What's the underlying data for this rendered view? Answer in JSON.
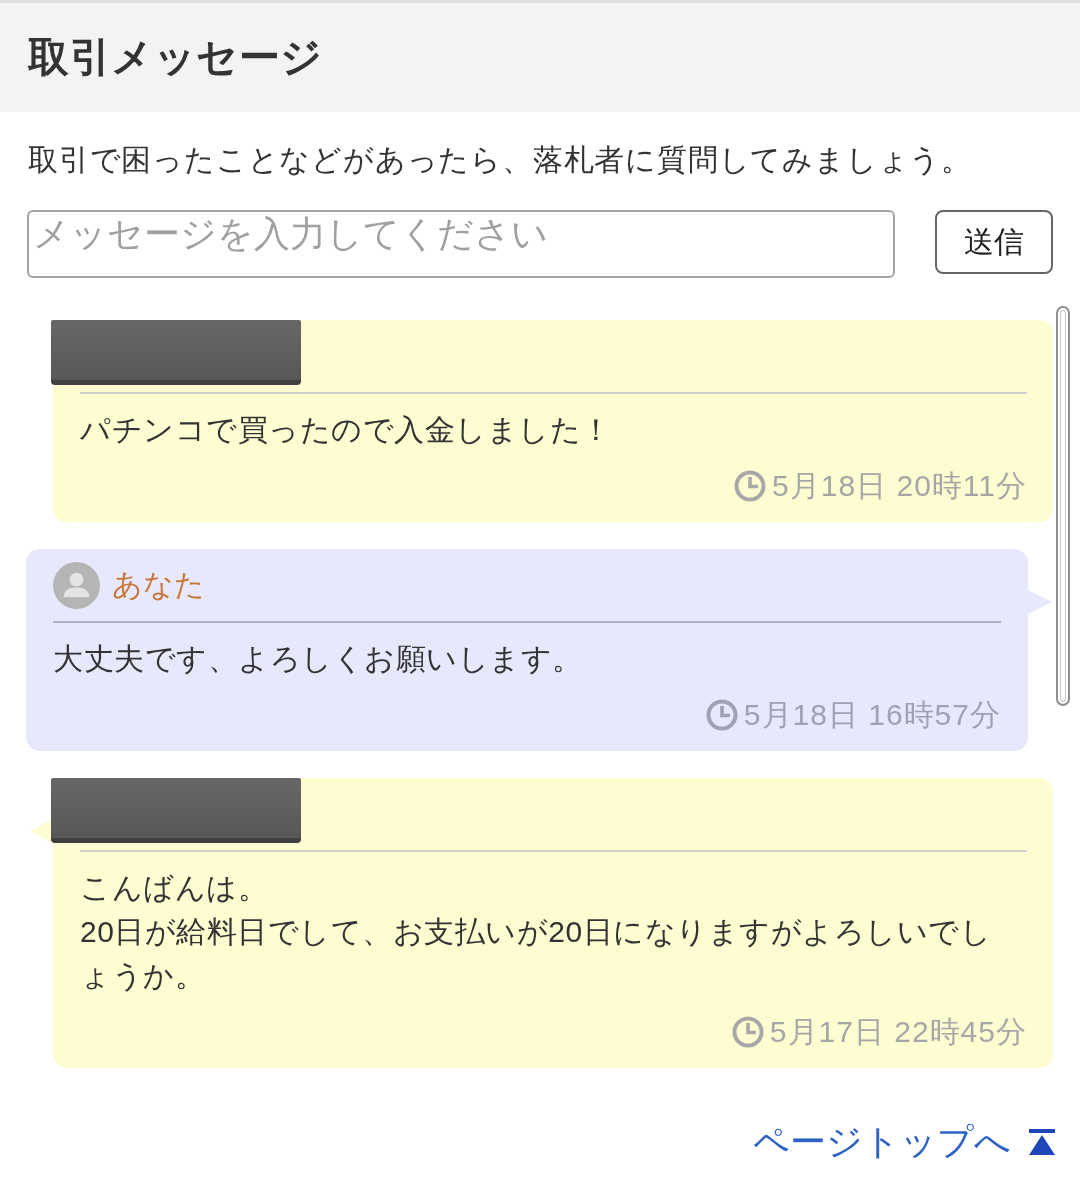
{
  "header": {
    "title": "取引メッセージ"
  },
  "intro": "取引で困ったことなどがあったら、落札者に質問してみましょう。",
  "compose": {
    "placeholder": "メッセージを入力してください",
    "send_button": "送信"
  },
  "messages": [
    {
      "kind": "other",
      "tail": false,
      "sender": {
        "kind": "redacted"
      },
      "body": "パチンコで買ったので入金しました！",
      "time": "5月18日 20時11分"
    },
    {
      "kind": "self",
      "tail": true,
      "sender": {
        "kind": "self",
        "name": "あなた"
      },
      "body": "大丈夫です、よろしくお願いします。",
      "time": "5月18日 16時57分"
    },
    {
      "kind": "other",
      "tail": true,
      "sender": {
        "kind": "redacted"
      },
      "body": "こんばんは。\n20日が給料日でして、お支払いが20日になりますがよろしいでしょうか。",
      "time": "5月17日 22時45分"
    }
  ],
  "page_top_link": "ページトップへ"
}
